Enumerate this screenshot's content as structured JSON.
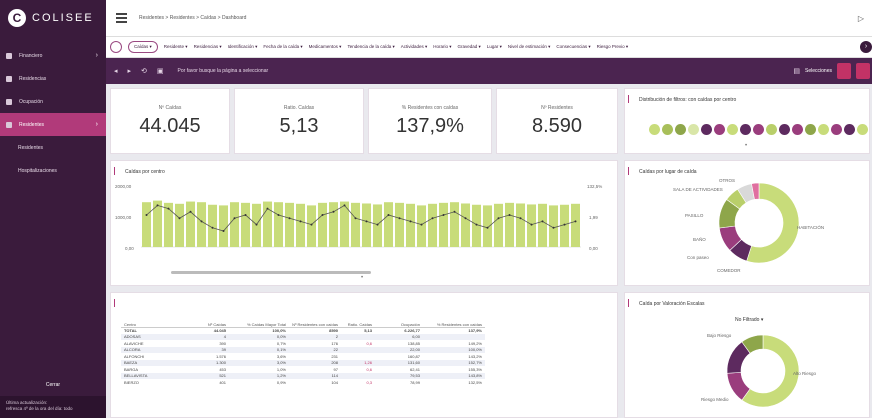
{
  "app": {
    "brand": "COLISEE",
    "logo_letter": "C"
  },
  "sidebar": {
    "items": [
      {
        "label": "Financiero",
        "icon": "wallet-icon",
        "chevron": true
      },
      {
        "label": "Residencias",
        "icon": "building-icon"
      },
      {
        "label": "Ocupación",
        "icon": "bed-icon"
      },
      {
        "label": "Residentes",
        "icon": "people-icon",
        "active": true,
        "chevron": true
      },
      {
        "label": "Residentes",
        "icon": "",
        "sub": true
      },
      {
        "label": "Hospitalizaciones",
        "icon": "",
        "sub": true
      }
    ],
    "bottom_button": "Cerrar",
    "user_line1": "Última actualización:",
    "user_line2": "refresca 4ª de la ora del día: todo"
  },
  "topbar": {
    "breadcrumb": "Residentes > Residentes > Caídas > Dashboard",
    "right_icon": "▷"
  },
  "filters": [
    "Caídas ▾",
    "Residente ▾",
    "Residencias ▾",
    "Identificación ▾",
    "Fecha de la caída ▾",
    "Medicamentos ▾",
    "Tendencia de la caída ▾",
    "Actividades ▾",
    "Horario ▾",
    "Gravedad ▾",
    "Lugar ▾",
    "Nivel de estimación ▾",
    "Consecuencias ▾",
    "Riesgo Previo ▾"
  ],
  "actionbar": {
    "text": "Por favor busque la página a seleccionar",
    "right_label": "Selecciones"
  },
  "kpis": [
    {
      "label": "Nº Caídas",
      "value": "44.045"
    },
    {
      "label": "Ratio. Caídas",
      "value": "5,13"
    },
    {
      "label": "% Residentes con caídas",
      "value": "137,9%"
    },
    {
      "label": "Nº Residentes",
      "value": "8.590"
    }
  ],
  "filter_card": {
    "title": "Distribución de filtros: con caídas por centro"
  },
  "bar_card": {
    "title": "Caídas por centro",
    "right_axis_top": "132,5%",
    "right_axis_mid": "1,99",
    "right_axis_bot": "0,00",
    "left_axis_top": "2000,00",
    "left_axis_mid": "1000,00",
    "left_axis_bot": "0,00"
  },
  "donut1": {
    "title": "Caídas por lugar de caída",
    "labels": {
      "a": "SALA DE ACTIVIDADES",
      "b": "HABITACIÓN",
      "c": "PASILLO",
      "d": "BAÑO",
      "e": "Con paseo",
      "f": "COMEDOR",
      "g": "OTROS"
    }
  },
  "table_card": {
    "headers": [
      "Centro",
      "Nº Caídas",
      "% Caídas Mayor Total",
      "Nº Residentes con caídas",
      "Ratio. Caídas",
      "Ocupación",
      "% Residentes con caídas"
    ],
    "rows": [
      [
        "TOTAL",
        "44.045",
        "100,0%",
        "8590",
        "5,13",
        "6.226,77",
        "137,9%"
      ],
      [
        "ADOSAS",
        "4",
        "0,0%",
        "2",
        "",
        "6,00",
        ""
      ],
      [
        "ALAVICHE",
        "390",
        "0,7%",
        "176",
        "0,6",
        "138,85",
        "149,2%"
      ],
      [
        "ALCORA",
        "39",
        "0,1%",
        "22",
        "",
        "22,00",
        "100,0%"
      ],
      [
        "ALFONCHI",
        "1.576",
        "3,6%",
        "231",
        "",
        "160,87",
        "143,2%"
      ],
      [
        "BAEZA",
        "1.300",
        "3,0%",
        "208",
        "1,26",
        "131,60",
        "152,7%"
      ],
      [
        "BARGA",
        "453",
        "1,0%",
        "97",
        "0,6",
        "62,41",
        "155,3%"
      ],
      [
        "BELLAVISTA",
        "521",
        "1,2%",
        "114",
        "",
        "79,53",
        "143,8%"
      ],
      [
        "BIERZO",
        "401",
        "0,9%",
        "104",
        "0,3",
        "78,99",
        "132,5%"
      ]
    ]
  },
  "donut2": {
    "title": "Caída por Valoración Escalas",
    "select": "No Filtrado ▾",
    "labels": {
      "a": "Bajo Riesgo",
      "b": "Alto Riesgo",
      "c": "Riesgo Medio",
      "d": "Riesgo Bajo"
    }
  },
  "chart_data": [
    {
      "type": "bar",
      "title": "Caídas por centro",
      "series": [
        {
          "name": "Nº Caídas",
          "values": [
            1400,
            1450,
            1380,
            1350,
            1420,
            1400,
            1320,
            1300,
            1400,
            1380,
            1350,
            1420,
            1400,
            1380,
            1350,
            1300,
            1380,
            1400,
            1420,
            1380,
            1360,
            1330,
            1400,
            1380,
            1350,
            1300,
            1350,
            1380,
            1400,
            1360,
            1320,
            1300,
            1350,
            1380,
            1360,
            1330,
            1350,
            1300,
            1320,
            1350
          ]
        },
        {
          "name": "Ratio",
          "values": [
            1.0,
            1.3,
            1.2,
            0.9,
            1.1,
            0.8,
            0.6,
            0.5,
            0.9,
            1.0,
            0.7,
            1.2,
            1.0,
            0.9,
            0.8,
            0.7,
            1.0,
            1.1,
            1.3,
            0.9,
            0.8,
            0.7,
            1.0,
            0.9,
            0.8,
            0.7,
            0.9,
            1.0,
            1.1,
            0.9,
            0.7,
            0.6,
            0.9,
            1.0,
            0.9,
            0.7,
            0.8,
            0.6,
            0.7,
            0.8
          ]
        }
      ]
    },
    {
      "type": "pie",
      "title": "Caídas por lugar de caída",
      "values": [
        55,
        8,
        10,
        12,
        6,
        6,
        3
      ],
      "colors": [
        "#c8dc7a",
        "#5d2a5f",
        "#9a3d7d",
        "#8ea64a",
        "#b9cf6a",
        "#d9d9d9",
        "#e070a0"
      ]
    },
    {
      "type": "pie",
      "title": "Caída por Valoración Escalas",
      "values": [
        60,
        14,
        16,
        10
      ],
      "colors": [
        "#c8dc7a",
        "#9a3d7d",
        "#5d2a5f",
        "#8ea64a"
      ]
    }
  ]
}
